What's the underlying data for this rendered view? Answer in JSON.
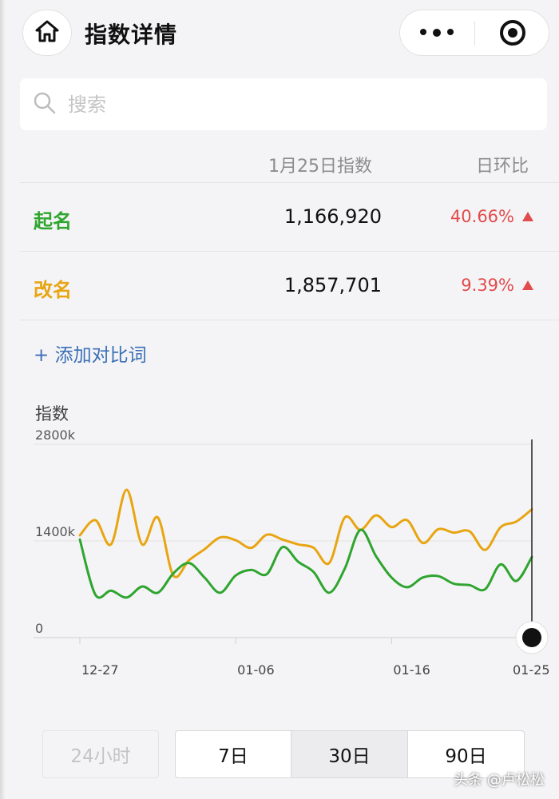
{
  "header": {
    "title": "指数详情",
    "home_icon": "home-icon",
    "more_icon": "more-dots-icon",
    "target_icon": "target-icon"
  },
  "search": {
    "placeholder": "搜索",
    "value": ""
  },
  "table": {
    "col_index": "1月25日指数",
    "col_change": "日环比",
    "rows": [
      {
        "keyword": "起名",
        "value": "1,166,920",
        "change": "40.66%",
        "trend": "up",
        "color": "#2fa52f"
      },
      {
        "keyword": "改名",
        "value": "1,857,701",
        "change": "9.39%",
        "trend": "up",
        "color": "#e8a512"
      }
    ]
  },
  "add_compare": "+ 添加对比词",
  "chart_data": {
    "type": "line",
    "ylabel": "指数",
    "yticks": [
      "2800k",
      "1400k",
      "0"
    ],
    "ylim": [
      0,
      2800
    ],
    "xticks": [
      {
        "label": "12-27",
        "day": 0
      },
      {
        "label": "01-06",
        "day": 10
      },
      {
        "label": "01-16",
        "day": 20
      },
      {
        "label": "01-25",
        "day": 29
      }
    ],
    "series": [
      {
        "name": "改名",
        "color": "#e8a512",
        "values": [
          1480,
          1700,
          1350,
          2140,
          1350,
          1740,
          900,
          1120,
          1280,
          1450,
          1410,
          1300,
          1490,
          1420,
          1350,
          1300,
          1080,
          1740,
          1560,
          1770,
          1600,
          1700,
          1370,
          1570,
          1520,
          1540,
          1270,
          1600,
          1680,
          1857
        ]
      },
      {
        "name": "起名",
        "color": "#2fa52f",
        "values": [
          1420,
          620,
          680,
          580,
          740,
          650,
          930,
          1080,
          870,
          650,
          900,
          980,
          920,
          1310,
          1100,
          950,
          650,
          1000,
          1560,
          1180,
          870,
          730,
          870,
          890,
          780,
          760,
          700,
          1060,
          820,
          1167
        ]
      }
    ]
  },
  "periods": [
    {
      "label": "24小时",
      "state": "disabled"
    },
    {
      "label": "7日",
      "state": "normal"
    },
    {
      "label": "30日",
      "state": "active"
    },
    {
      "label": "90日",
      "state": "normal"
    }
  ],
  "watermark": "头条 @卢松松"
}
